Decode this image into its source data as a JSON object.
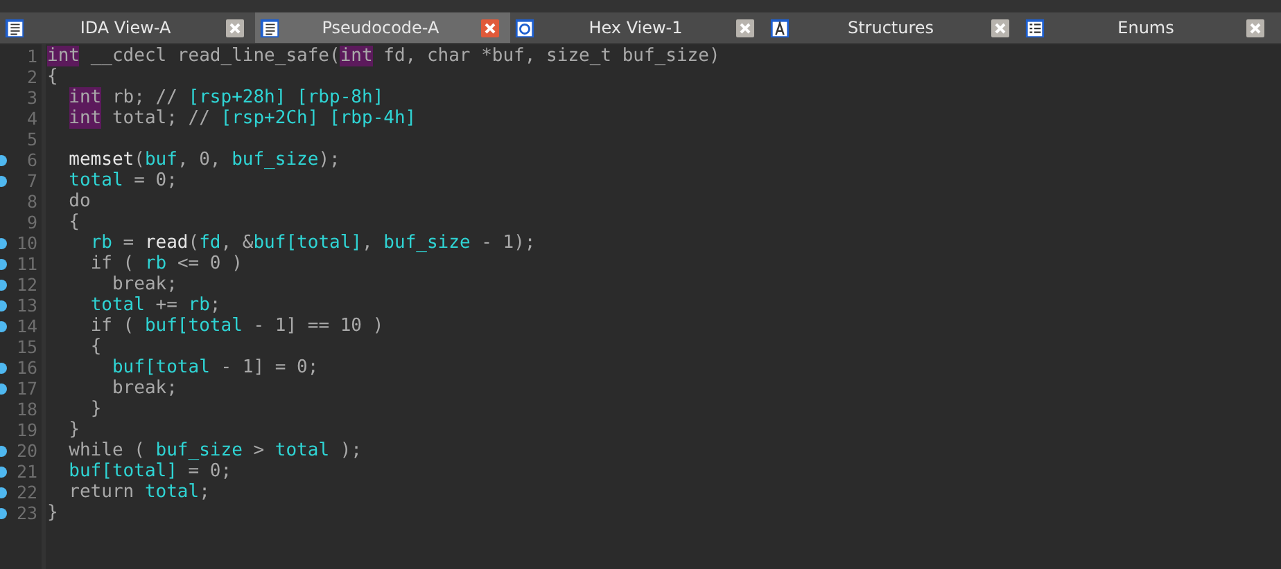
{
  "tabs": [
    {
      "label": "IDA View-A",
      "kind": "listing",
      "selected": false
    },
    {
      "label": "Pseudocode-A",
      "kind": "listing",
      "selected": true
    },
    {
      "label": "Hex View-1",
      "kind": "hex",
      "selected": false
    },
    {
      "label": "Structures",
      "kind": "struct",
      "selected": false
    },
    {
      "label": "Enums",
      "kind": "enum",
      "selected": false
    }
  ],
  "lines": [
    {
      "number": "1",
      "breakpoint": false,
      "tokens": [
        {
          "kind": "type",
          "text": "int"
        },
        {
          "kind": "plain",
          "text": " __cdecl read_line_safe("
        },
        {
          "kind": "type",
          "text": "int"
        },
        {
          "kind": "plain",
          "text": " fd, char *buf, size_t buf_size)"
        }
      ]
    },
    {
      "number": "2",
      "breakpoint": false,
      "tokens": [
        {
          "kind": "plain",
          "text": "{"
        }
      ]
    },
    {
      "number": "3",
      "breakpoint": false,
      "tokens": [
        {
          "kind": "type",
          "text": "  int"
        },
        {
          "kind": "plain",
          "text": " rb; // "
        },
        {
          "kind": "var",
          "text": "[rsp+28h] [rbp-8h]"
        }
      ]
    },
    {
      "number": "4",
      "breakpoint": false,
      "tokens": [
        {
          "kind": "type",
          "text": "  int"
        },
        {
          "kind": "plain",
          "text": " total; // "
        },
        {
          "kind": "var",
          "text": "[rsp+2Ch] [rbp-4h]"
        }
      ]
    },
    {
      "number": "5",
      "breakpoint": false
    },
    {
      "number": "6",
      "breakpoint": true,
      "tokens": [
        {
          "kind": "func",
          "text": "  memset"
        },
        {
          "kind": "plain",
          "text": "("
        },
        {
          "kind": "var",
          "text": "buf"
        },
        {
          "kind": "plain",
          "text": ", 0, "
        },
        {
          "kind": "var",
          "text": "buf_size"
        },
        {
          "kind": "plain",
          "text": ");"
        }
      ]
    },
    {
      "number": "7",
      "breakpoint": true,
      "tokens": [
        {
          "kind": "var",
          "text": "  total"
        },
        {
          "kind": "plain",
          "text": " = 0;"
        }
      ]
    },
    {
      "number": "8",
      "breakpoint": false,
      "tokens": [
        {
          "kind": "plain",
          "text": "  do"
        }
      ]
    },
    {
      "number": "9",
      "breakpoint": false,
      "tokens": [
        {
          "kind": "plain",
          "text": "  {"
        }
      ]
    },
    {
      "number": "10",
      "breakpoint": true,
      "tokens": [
        {
          "kind": "var",
          "text": "    rb"
        },
        {
          "kind": "plain",
          "text": " = "
        },
        {
          "kind": "func",
          "text": "read"
        },
        {
          "kind": "plain",
          "text": "("
        },
        {
          "kind": "var",
          "text": "fd"
        },
        {
          "kind": "plain",
          "text": ", &"
        },
        {
          "kind": "var",
          "text": "buf[total]"
        },
        {
          "kind": "plain",
          "text": ", "
        },
        {
          "kind": "var",
          "text": "buf_size"
        },
        {
          "kind": "plain",
          "text": " - 1);"
        }
      ]
    },
    {
      "number": "11",
      "breakpoint": true,
      "tokens": [
        {
          "kind": "plain",
          "text": "    if ( "
        },
        {
          "kind": "var",
          "text": "rb"
        },
        {
          "kind": "plain",
          "text": " <= 0 )"
        }
      ]
    },
    {
      "number": "12",
      "breakpoint": true,
      "tokens": [
        {
          "kind": "plain",
          "text": "      break;"
        }
      ]
    },
    {
      "number": "13",
      "breakpoint": true,
      "tokens": [
        {
          "kind": "var",
          "text": "    total"
        },
        {
          "kind": "plain",
          "text": " += "
        },
        {
          "kind": "var",
          "text": "rb"
        },
        {
          "kind": "plain",
          "text": ";"
        }
      ]
    },
    {
      "number": "14",
      "breakpoint": true,
      "tokens": [
        {
          "kind": "plain",
          "text": "    if ( "
        },
        {
          "kind": "var",
          "text": "buf[total"
        },
        {
          "kind": "plain",
          "text": " - 1] == 10 )"
        }
      ]
    },
    {
      "number": "15",
      "breakpoint": false,
      "tokens": [
        {
          "kind": "plain",
          "text": "    {"
        }
      ]
    },
    {
      "number": "16",
      "breakpoint": true,
      "tokens": [
        {
          "kind": "var",
          "text": "      buf[total"
        },
        {
          "kind": "plain",
          "text": " - 1] = 0;"
        }
      ]
    },
    {
      "number": "17",
      "breakpoint": true,
      "tokens": [
        {
          "kind": "plain",
          "text": "      break;"
        }
      ]
    },
    {
      "number": "18",
      "breakpoint": false,
      "tokens": [
        {
          "kind": "plain",
          "text": "    }"
        }
      ]
    },
    {
      "number": "19",
      "breakpoint": false,
      "tokens": [
        {
          "kind": "plain",
          "text": "  }"
        }
      ]
    },
    {
      "number": "20",
      "breakpoint": true,
      "tokens": [
        {
          "kind": "plain",
          "text": "  while ( "
        },
        {
          "kind": "var",
          "text": "buf_size"
        },
        {
          "kind": "plain",
          "text": " > "
        },
        {
          "kind": "var",
          "text": "total"
        },
        {
          "kind": "plain",
          "text": " );"
        }
      ]
    },
    {
      "number": "21",
      "breakpoint": true,
      "tokens": [
        {
          "kind": "var",
          "text": "  buf[total]"
        },
        {
          "kind": "plain",
          "text": " = 0;"
        }
      ]
    },
    {
      "number": "22",
      "breakpoint": true,
      "tokens": [
        {
          "kind": "plain",
          "text": "  return "
        },
        {
          "kind": "var",
          "text": "total"
        },
        {
          "kind": "plain",
          "text": ";"
        }
      ]
    },
    {
      "number": "23",
      "breakpoint": true,
      "tokens": [
        {
          "kind": "plain",
          "text": "}"
        }
      ]
    }
  ]
}
